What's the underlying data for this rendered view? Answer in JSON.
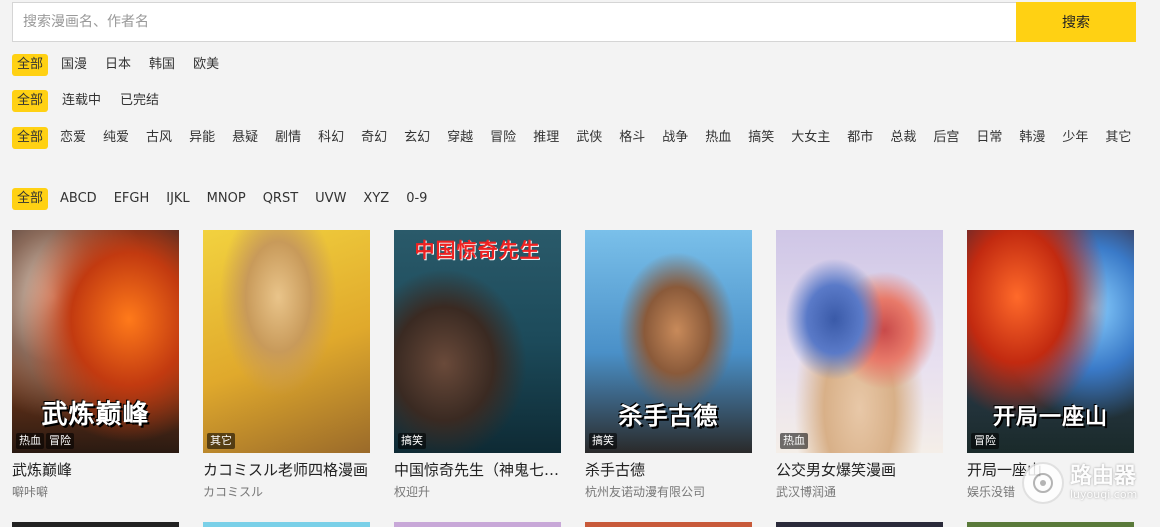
{
  "search": {
    "placeholder": "搜索漫画名、作者名",
    "button_label": "搜索"
  },
  "filters": {
    "region": [
      "全部",
      "国漫",
      "日本",
      "韩国",
      "欧美"
    ],
    "status": [
      "全部",
      "连载中",
      "已完结"
    ],
    "genre": [
      "全部",
      "恋爱",
      "纯爱",
      "古风",
      "异能",
      "悬疑",
      "剧情",
      "科幻",
      "奇幻",
      "玄幻",
      "穿越",
      "冒险",
      "推理",
      "武侠",
      "格斗",
      "战争",
      "热血",
      "搞笑",
      "大女主",
      "都市",
      "总裁",
      "后宫",
      "日常",
      "韩漫",
      "少年",
      "其它"
    ],
    "letter": [
      "全部",
      "ABCD",
      "EFGH",
      "IJKL",
      "MNOP",
      "QRST",
      "UVW",
      "XYZ",
      "0-9"
    ],
    "active_color": "#ffd113"
  },
  "comics": [
    {
      "title": "武炼巅峰",
      "author": "噼咔噼",
      "tags": [
        "热血",
        "冒险"
      ],
      "cover_text": "武炼巅峰"
    },
    {
      "title": "カコミスル老师四格漫画",
      "author": "カコミスル",
      "tags": [
        "其它"
      ],
      "cover_text": ""
    },
    {
      "title": "中国惊奇先生（神鬼七杀令）",
      "author": "权迎升",
      "tags": [
        "搞笑"
      ],
      "cover_text": "中国惊奇先生"
    },
    {
      "title": "杀手古德",
      "author": "杭州友诺动漫有限公司",
      "tags": [
        "搞笑"
      ],
      "cover_text": "杀手古德"
    },
    {
      "title": "公交男女爆笑漫画",
      "author": "武汉博润通",
      "tags": [
        "热血"
      ],
      "cover_text": ""
    },
    {
      "title": "开局一座山",
      "author": "娱乐没错",
      "tags": [
        "冒险"
      ],
      "cover_text": "开局一座山"
    }
  ],
  "watermark": {
    "line1": "路由器",
    "line2": "luyouqi.com"
  }
}
